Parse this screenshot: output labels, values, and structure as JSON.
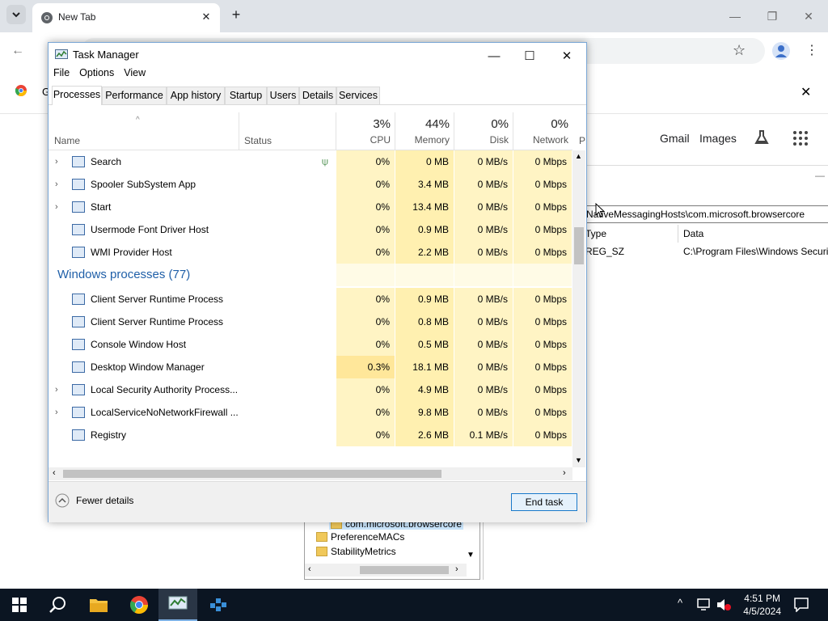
{
  "chrome": {
    "tab_title": "New Tab",
    "links": {
      "gmail": "Gmail",
      "images": "Images"
    },
    "bookmark_partial": "G"
  },
  "regedit": {
    "path": "NativeMessagingHosts\\com.microsoft.browsercore",
    "columns": {
      "type": "Type",
      "data": "Data"
    },
    "value": {
      "type": "REG_SZ",
      "data": "C:\\Program Files\\Windows Securit"
    },
    "tree": [
      "com.microsoft.browsercore",
      "PreferenceMACs",
      "StabilityMetrics"
    ]
  },
  "task_manager": {
    "title": "Task Manager",
    "menu": [
      "File",
      "Options",
      "View"
    ],
    "tabs": [
      "Processes",
      "Performance",
      "App history",
      "Startup",
      "Users",
      "Details",
      "Services"
    ],
    "columns": {
      "name": "Name",
      "status": "Status",
      "cpu": {
        "pct": "3%",
        "label": "CPU"
      },
      "memory": {
        "pct": "44%",
        "label": "Memory"
      },
      "disk": {
        "pct": "0%",
        "label": "Disk"
      },
      "network": {
        "pct": "0%",
        "label": "Network"
      },
      "partial": "P"
    },
    "rows": [
      {
        "name": "Search",
        "expandable": true,
        "cpu": "0%",
        "memory": "0 MB",
        "disk": "0 MB/s",
        "network": "0 Mbps"
      },
      {
        "name": "Spooler SubSystem App",
        "expandable": true,
        "cpu": "0%",
        "memory": "3.4 MB",
        "disk": "0 MB/s",
        "network": "0 Mbps"
      },
      {
        "name": "Start",
        "expandable": true,
        "cpu": "0%",
        "memory": "13.4 MB",
        "disk": "0 MB/s",
        "network": "0 Mbps"
      },
      {
        "name": "Usermode Font Driver Host",
        "expandable": false,
        "cpu": "0%",
        "memory": "0.9 MB",
        "disk": "0 MB/s",
        "network": "0 Mbps"
      },
      {
        "name": "WMI Provider Host",
        "expandable": false,
        "cpu": "0%",
        "memory": "2.2 MB",
        "disk": "0 MB/s",
        "network": "0 Mbps"
      }
    ],
    "group_label": "Windows processes (77)",
    "win_rows": [
      {
        "name": "Client Server Runtime Process",
        "expandable": false,
        "cpu": "0%",
        "memory": "0.9 MB",
        "disk": "0 MB/s",
        "network": "0 Mbps"
      },
      {
        "name": "Client Server Runtime Process",
        "expandable": false,
        "cpu": "0%",
        "memory": "0.8 MB",
        "disk": "0 MB/s",
        "network": "0 Mbps"
      },
      {
        "name": "Console Window Host",
        "expandable": false,
        "cpu": "0%",
        "memory": "0.5 MB",
        "disk": "0 MB/s",
        "network": "0 Mbps"
      },
      {
        "name": "Desktop Window Manager",
        "expandable": false,
        "cpu": "0.3%",
        "memory": "18.1 MB",
        "disk": "0 MB/s",
        "network": "0 Mbps"
      },
      {
        "name": "Local Security Authority Process...",
        "expandable": true,
        "cpu": "0%",
        "memory": "4.9 MB",
        "disk": "0 MB/s",
        "network": "0 Mbps"
      },
      {
        "name": "LocalServiceNoNetworkFirewall ...",
        "expandable": true,
        "cpu": "0%",
        "memory": "9.8 MB",
        "disk": "0 MB/s",
        "network": "0 Mbps"
      },
      {
        "name": "Registry",
        "expandable": false,
        "cpu": "0%",
        "memory": "2.6 MB",
        "disk": "0.1 MB/s",
        "network": "0 Mbps"
      }
    ],
    "fewer_details": "Fewer details",
    "end_task": "End task"
  },
  "taskbar": {
    "time": "4:51 PM",
    "date": "4/5/2024"
  }
}
